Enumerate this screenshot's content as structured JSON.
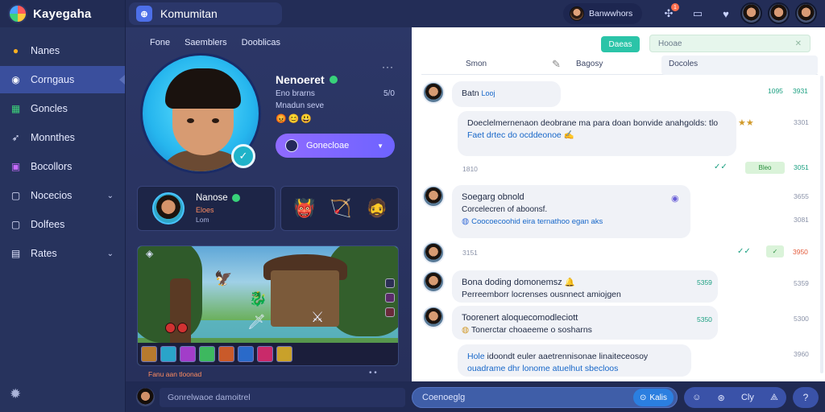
{
  "app": {
    "name": "Kayegaha"
  },
  "sidebar": {
    "items": [
      {
        "label": "Nanes",
        "icon": "coin-icon",
        "glyph": "●",
        "color": "#ffb020"
      },
      {
        "label": "Corngaus",
        "icon": "globe-icon",
        "glyph": "◉",
        "color": "#ffffff",
        "active": true
      },
      {
        "label": "Goncles",
        "icon": "grid-icon",
        "glyph": "▦",
        "color": "#3dd27a"
      },
      {
        "label": "Monnthes",
        "icon": "rocket-icon",
        "glyph": "➶",
        "color": "#dfe4ff"
      },
      {
        "label": "Bocollors",
        "icon": "picture-icon",
        "glyph": "▣",
        "color": "#c86bff"
      },
      {
        "label": "Nocecios",
        "icon": "square-icon",
        "glyph": "▢",
        "color": "#dfe4ff",
        "chevron": "⌄"
      },
      {
        "label": "Dolfees",
        "icon": "square-icon",
        "glyph": "▢",
        "color": "#dfe4ff",
        "chevron": ""
      },
      {
        "label": "Rates",
        "icon": "folder-icon",
        "glyph": "▤",
        "color": "#dfe4ff",
        "chevron": "⌄"
      }
    ],
    "bottom_icon": "settings-icon"
  },
  "topbar": {
    "title": "Komumitan",
    "user_name": "Banwwhors",
    "notif_count": "1"
  },
  "profile": {
    "tabs": [
      "Fone",
      "Saemblers",
      "Dooblicas"
    ],
    "name": "Nenoeret",
    "subtitle": "Eno brarns",
    "status": "Mnadun seve",
    "count": "5/0",
    "button_label": "Gonecloae"
  },
  "friend_card": {
    "name": "Nanose",
    "sub": "Eloes",
    "sub2": "Lom"
  },
  "game": {
    "footer": "Fanu aan tloonad"
  },
  "chat": {
    "header_button": "Daeas",
    "search_placeholder": "Hooae",
    "tabs": [
      "Smon",
      "Bagosy",
      "Docoles"
    ],
    "messages": [
      {
        "title": "Batn",
        "line": "Looj",
        "time": "1095",
        "meta": "3931"
      },
      {
        "text": "Doeclelmernenaon deobrane ma para doan bonvide anahgolds: tlo",
        "link": "Faet drtec do ocddeonoe",
        "time": "3301",
        "sent": "1810",
        "tag": "Bleo",
        "meta2": "3051"
      },
      {
        "title": "Soegarg obnold",
        "line": "Corcelecren of aboonsf.",
        "link": "Coocoecoohid eira ternathoo egan aks",
        "time": "3655",
        "sent": "3151",
        "meta2": "3081"
      },
      {
        "title": "Bona doding domonemsz",
        "line": "Perreemborr locrenses ousnnect amiojgen",
        "meta": "5359",
        "time": "3950"
      },
      {
        "title": "Toorenert aloquecomodleciott",
        "line": "Tonerctar choaeeme o sosharns",
        "meta": "5350",
        "time": "5300"
      },
      {
        "title": "Hole",
        "line": "idoondt euler aaetrennisonae linaiteceosoy",
        "line2": "ouadrame dhr lonome atuelhut sbecloos",
        "time": "3960"
      }
    ]
  },
  "bottom": {
    "left_placeholder": "Gonrelwaoe damoitrel",
    "input_value": "Coenoeglg",
    "send_label": "Kalis",
    "tools_label": "Cly"
  }
}
